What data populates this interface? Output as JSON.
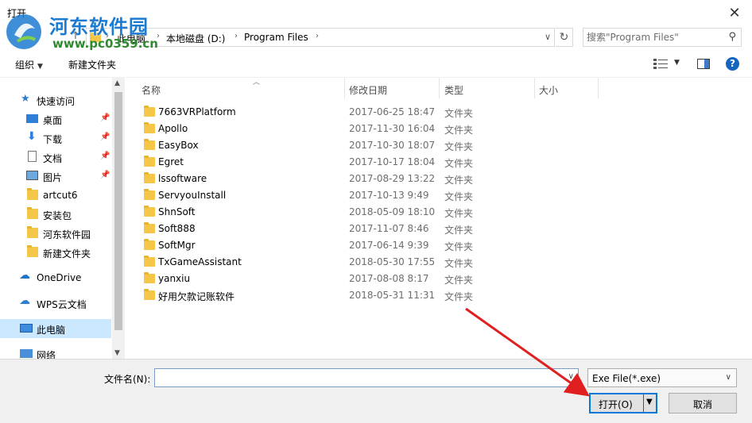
{
  "window": {
    "title": "打开"
  },
  "watermark": {
    "title": "河东软件园",
    "url": "www.pc0359.cn"
  },
  "address": {
    "crumbs": [
      "此电脑",
      "本地磁盘 (D:)",
      "Program Files"
    ],
    "search_placeholder": "搜索\"Program Files\""
  },
  "toolbar": {
    "organize": "组织",
    "new_folder": "新建文件夹"
  },
  "sidebar": {
    "items": [
      {
        "label": "快速访问",
        "icon": "star-icon",
        "pinned": false
      },
      {
        "label": "桌面",
        "icon": "desktop-icon",
        "pinned": true
      },
      {
        "label": "下载",
        "icon": "download-icon",
        "pinned": true
      },
      {
        "label": "文档",
        "icon": "document-icon",
        "pinned": true
      },
      {
        "label": "图片",
        "icon": "picture-icon",
        "pinned": true
      },
      {
        "label": "artcut6",
        "icon": "folder-icon",
        "pinned": false
      },
      {
        "label": "安装包",
        "icon": "folder-icon",
        "pinned": false
      },
      {
        "label": "河东软件园",
        "icon": "folder-icon",
        "pinned": false
      },
      {
        "label": "新建文件夹",
        "icon": "folder-icon",
        "pinned": false
      },
      {
        "label": "OneDrive",
        "icon": "cloud-icon",
        "pinned": false
      },
      {
        "label": "WPS云文档",
        "icon": "cloud-icon",
        "pinned": false
      },
      {
        "label": "此电脑",
        "icon": "computer-icon",
        "pinned": false,
        "selected": true
      },
      {
        "label": "网络",
        "icon": "network-icon",
        "pinned": false
      }
    ]
  },
  "columns": {
    "name": "名称",
    "modified": "修改日期",
    "type": "类型",
    "size": "大小"
  },
  "files": [
    {
      "name": "7663VRPlatform",
      "modified": "2017-06-25 18:47",
      "type": "文件夹"
    },
    {
      "name": "Apollo",
      "modified": "2017-11-30 16:04",
      "type": "文件夹"
    },
    {
      "name": "EasyBox",
      "modified": "2017-10-30 18:07",
      "type": "文件夹"
    },
    {
      "name": "Egret",
      "modified": "2017-10-17 18:04",
      "type": "文件夹"
    },
    {
      "name": "lssoftware",
      "modified": "2017-08-29 13:22",
      "type": "文件夹"
    },
    {
      "name": "ServyouInstall",
      "modified": "2017-10-13 9:49",
      "type": "文件夹"
    },
    {
      "name": "ShnSoft",
      "modified": "2018-05-09 18:10",
      "type": "文件夹"
    },
    {
      "name": "Soft888",
      "modified": "2017-11-07 8:46",
      "type": "文件夹"
    },
    {
      "name": "SoftMgr",
      "modified": "2017-06-14 9:39",
      "type": "文件夹"
    },
    {
      "name": "TxGameAssistant",
      "modified": "2018-05-30 17:55",
      "type": "文件夹"
    },
    {
      "name": "yanxiu",
      "modified": "2017-08-08 8:17",
      "type": "文件夹"
    },
    {
      "name": "好用欠款记账软件",
      "modified": "2018-05-31 11:31",
      "type": "文件夹"
    }
  ],
  "bottom": {
    "filename_label": "文件名(N):",
    "filename_value": "",
    "filetype": "Exe File(*.exe)",
    "open": "打开(O)",
    "cancel": "取消"
  },
  "colors": {
    "accent": "#0078d7",
    "selection": "#cce8ff",
    "folder": "#f5c749",
    "annotation_arrow": "#e02020"
  }
}
